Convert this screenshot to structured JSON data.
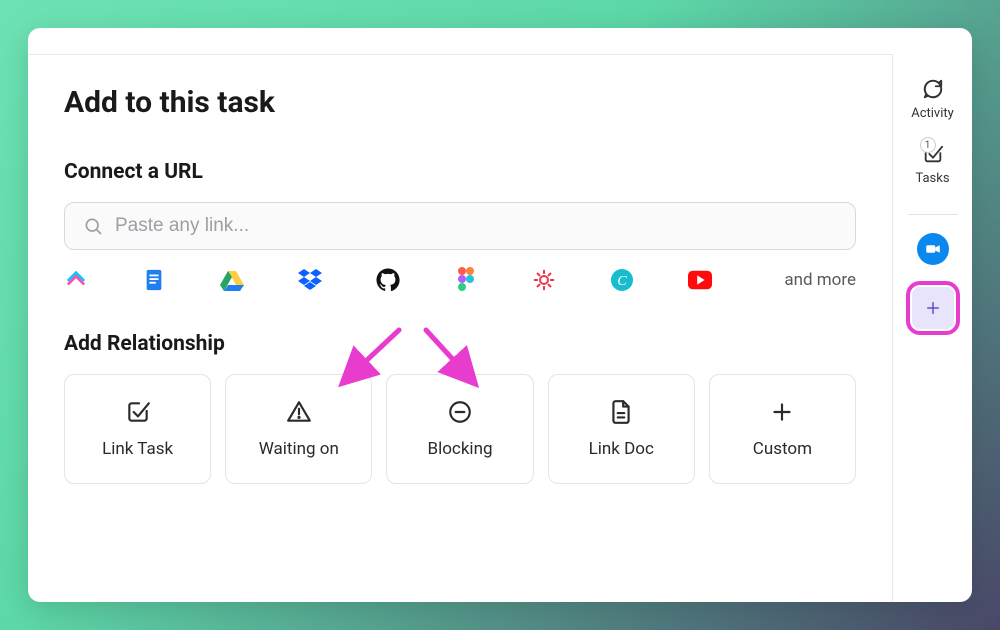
{
  "header": {
    "title": "Add to this task"
  },
  "connect": {
    "title": "Connect a URL",
    "placeholder": "Paste any link...",
    "and_more": "and more",
    "services": [
      {
        "name": "clickup"
      },
      {
        "name": "google-docs"
      },
      {
        "name": "google-drive"
      },
      {
        "name": "dropbox"
      },
      {
        "name": "github"
      },
      {
        "name": "figma"
      },
      {
        "name": "loom"
      },
      {
        "name": "canva"
      },
      {
        "name": "youtube"
      }
    ]
  },
  "relationship": {
    "title": "Add Relationship",
    "cards": [
      {
        "label": "Link Task"
      },
      {
        "label": "Waiting on"
      },
      {
        "label": "Blocking"
      },
      {
        "label": "Link Doc"
      },
      {
        "label": "Custom"
      }
    ]
  },
  "sidebar": {
    "activity": "Activity",
    "tasks": "Tasks",
    "tasks_badge": "1"
  }
}
